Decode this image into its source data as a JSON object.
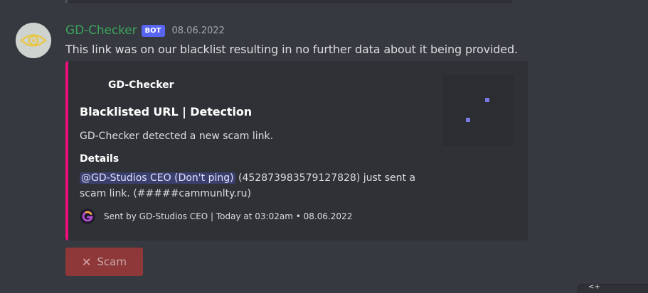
{
  "message": {
    "author": "GD-Checker",
    "bot_tag": "BOT",
    "timestamp": "08.06.2022",
    "text": "This link was on our blacklist resulting in no further data about it being provided."
  },
  "embed": {
    "accent_color": "#ed0f7a",
    "author_name": "GD-Checker",
    "title": "Blacklisted URL | Detection",
    "description": "GD-Checker detected a new scam link.",
    "field_name": "Details",
    "field_mention": "@GD-Studios CEO (Don't ping)",
    "field_value_rest": " (452873983579127828) just sent a scam link. (#####cammunlty.ru)",
    "footer_text": "Sent by GD-Studios CEO | Today at 03:02am • 08.06.2022"
  },
  "button": {
    "label": "Scam",
    "icon": "x-icon",
    "color": "#8f383a"
  },
  "corner_tab_text": "<+"
}
